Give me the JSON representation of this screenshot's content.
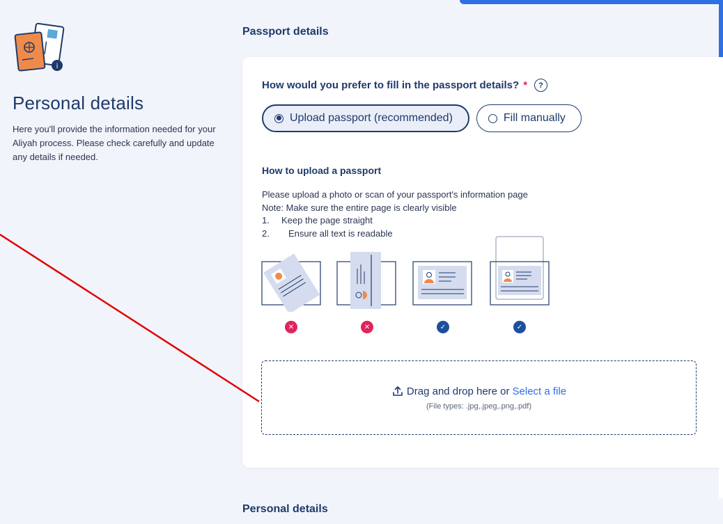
{
  "left": {
    "title": "Personal details",
    "description": "Here you'll provide the information needed for your Aliyah process. Please check carefully and update any details if needed."
  },
  "sections": {
    "passport_heading": "Passport details",
    "personal_heading": "Personal details"
  },
  "passport_card": {
    "question": "How would you prefer to fill in the passport details?",
    "required_mark": "*",
    "help_label": "?",
    "options": [
      {
        "label": "Upload passport (recommended)",
        "selected": true
      },
      {
        "label": "Fill manually",
        "selected": false
      }
    ],
    "how_to_title": "How to upload a passport",
    "instructions": {
      "line1": "Please upload a photo or scan of your passport's information page",
      "line2": "Note: Make sure the entire page is clearly visible",
      "steps": [
        {
          "num": "1.",
          "text": "Keep the page straight"
        },
        {
          "num": "2.",
          "text": "Ensure all text is readable"
        }
      ]
    },
    "examples": [
      {
        "icon": "tilted-passport-icon",
        "status": "bad"
      },
      {
        "icon": "rotated-passport-icon",
        "status": "bad"
      },
      {
        "icon": "straight-passport-icon",
        "status": "good"
      },
      {
        "icon": "passport-in-sleeve-icon",
        "status": "good"
      }
    ],
    "dropzone": {
      "text": "Drag and drop here or",
      "link": "Select a file",
      "file_types": "(File types: .jpg,.jpeg,.png,.pdf)"
    }
  },
  "colors": {
    "primary": "#1e3a6b",
    "link": "#2f6fe4",
    "error": "#e0245e",
    "success": "#1e4f9c",
    "background": "#f1f4fa",
    "annotation": "#e00000"
  }
}
